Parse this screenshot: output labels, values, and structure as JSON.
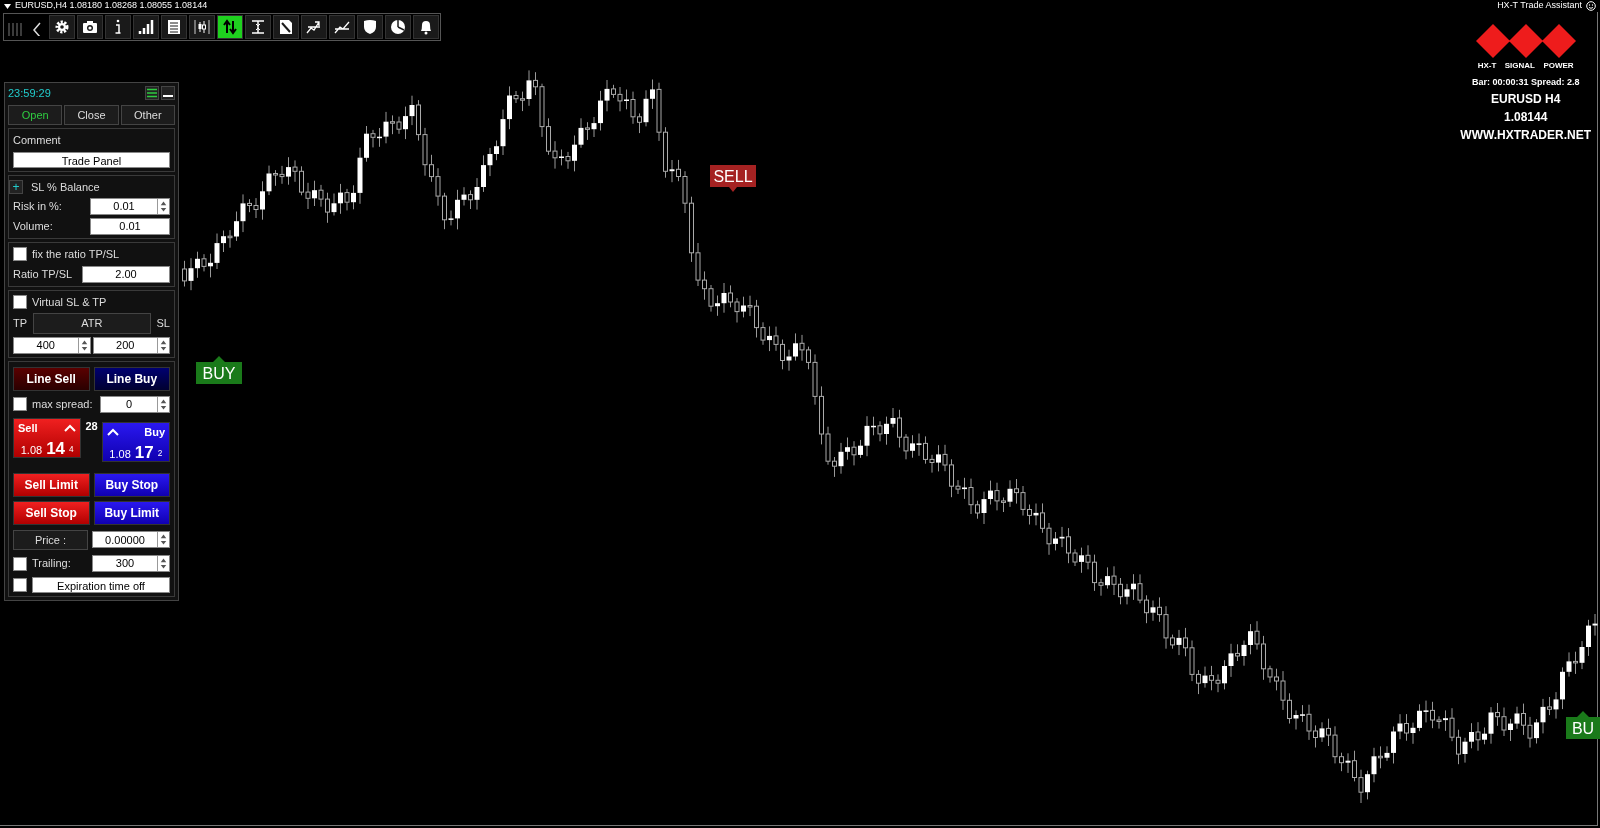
{
  "chart_header": {
    "symbol_info": "EURUSD,H4  1.08180 1.08268 1.08055 1.08144",
    "assistant_label": "HX-T Trade Assistant"
  },
  "toolbar": {
    "buttons": [
      {
        "kind": "grip",
        "selected": false
      },
      {
        "kind": "back",
        "selected": false
      },
      {
        "kind": "gear",
        "selected": false
      },
      {
        "kind": "camera",
        "selected": false
      },
      {
        "kind": "info",
        "selected": false
      },
      {
        "kind": "bars",
        "selected": false
      },
      {
        "kind": "list",
        "selected": false
      },
      {
        "kind": "candles",
        "selected": false
      },
      {
        "kind": "updown",
        "selected": true
      },
      {
        "kind": "ibeam",
        "selected": false
      },
      {
        "kind": "doc",
        "selected": false
      },
      {
        "kind": "trendup",
        "selected": false
      },
      {
        "kind": "trendline",
        "selected": false
      },
      {
        "kind": "shield",
        "selected": false
      },
      {
        "kind": "pie",
        "selected": false
      },
      {
        "kind": "bell",
        "selected": false
      }
    ]
  },
  "panel": {
    "time": "23:59:29",
    "tabs": [
      {
        "label": "Open",
        "selected": true
      },
      {
        "label": "Close",
        "selected": false
      },
      {
        "label": "Other",
        "selected": false
      }
    ],
    "comment": {
      "label": "Comment",
      "value": "Trade Panel"
    },
    "sl_balance": {
      "toggle": "+",
      "title": "SL % Balance",
      "risk_label": "Risk in %:",
      "risk_value": "0.01",
      "volume_label": "Volume:",
      "volume_value": "0.01"
    },
    "ratio": {
      "checked": false,
      "title": "fix the ratio TP/SL",
      "label": "Ratio TP/SL",
      "value": "2.00"
    },
    "virtual": {
      "checked": false,
      "title": "Virtual SL & TP",
      "tp_label": "TP",
      "mode": "ATR",
      "sl_label": "SL",
      "tp_value": "400",
      "sl_value": "200"
    },
    "line_buttons": [
      "Line Sell",
      "Line Buy"
    ],
    "max_spread": {
      "checked": false,
      "label": "max spread:",
      "value": "0"
    },
    "sell": {
      "label": "Sell",
      "price_main": "1.08",
      "price_big": "14",
      "price_small": "4"
    },
    "spread": "28",
    "buy": {
      "label": "Buy",
      "price_main": "1.08",
      "price_big": "17",
      "price_small": "2"
    },
    "order_buttons": [
      {
        "label": "Sell Limit",
        "kind": "sell"
      },
      {
        "label": "Buy Stop",
        "kind": "buy"
      },
      {
        "label": "Sell Stop",
        "kind": "sell"
      },
      {
        "label": "Buy Limit",
        "kind": "buy"
      }
    ],
    "price": {
      "label": "Price :",
      "value": "0.00000"
    },
    "trailing": {
      "checked": false,
      "label": "Trailing:",
      "value": "300"
    },
    "expiration": {
      "checked": false,
      "label": "Expiration time off"
    }
  },
  "branding": {
    "words": [
      "HX-T",
      "SIGNAL",
      "POWER"
    ],
    "bar_info": "Bar: 00:00:31 Spread: 2.8",
    "symbol": "EURUSD H4",
    "price": "1.08144",
    "website": "WWW.HXTRADER.NET"
  },
  "signals": [
    {
      "label": "BUY",
      "kind": "buy"
    },
    {
      "label": "SELL",
      "kind": "sell"
    },
    {
      "label": "BU",
      "kind": "buy"
    }
  ]
}
